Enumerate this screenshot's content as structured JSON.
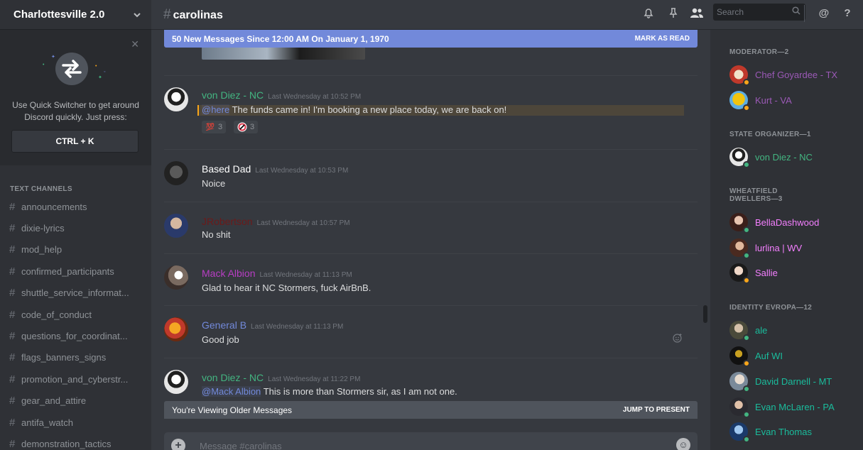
{
  "server": {
    "name": "Charlottesville 2.0"
  },
  "quick_switcher": {
    "text": "Use Quick Switcher to get around Discord quickly. Just press:",
    "shortcut": "CTRL + K"
  },
  "channels": {
    "category": "TEXT CHANNELS",
    "items": [
      "announcements",
      "dixie-lyrics",
      "mod_help",
      "confirmed_participants",
      "shuttle_service_informat...",
      "code_of_conduct",
      "questions_for_coordinat...",
      "flags_banners_signs",
      "promotion_and_cyberstr...",
      "gear_and_attire",
      "antifa_watch",
      "demonstration_tactics"
    ]
  },
  "header": {
    "channel": "carolinas",
    "search_placeholder": "Search"
  },
  "new_messages_bar": {
    "text": "50 New Messages Since 12:00 AM On January 1, 1970",
    "action": "MARK AS READ"
  },
  "older_messages_bar": {
    "text": "You're Viewing Older Messages",
    "action": "JUMP TO PRESENT"
  },
  "messages": [
    {
      "author": "von Diez - NC",
      "color": "#43b581",
      "timestamp": "Last Wednesday at 10:52 PM",
      "mention": "@here",
      "text": "The funds came in! I'm booking a new place today, we are back on!",
      "reactions": [
        {
          "count": "3"
        },
        {
          "count": "3"
        }
      ]
    },
    {
      "author": "Based Dad",
      "color": "#ffffff",
      "timestamp": "Last Wednesday at 10:53 PM",
      "text": "Noice"
    },
    {
      "author": "JRobertson",
      "color": "#6b1a1a",
      "timestamp": "Last Wednesday at 10:57 PM",
      "text": "No shit"
    },
    {
      "author": "Mack Albion",
      "color": "#b83ec4",
      "timestamp": "Last Wednesday at 11:13 PM",
      "text": "Glad to hear it NC Stormers, fuck AirBnB."
    },
    {
      "author": "General B",
      "color": "#7289da",
      "timestamp": "Last Wednesday at 11:13 PM",
      "text": "Good job"
    },
    {
      "author": "von Diez - NC",
      "color": "#43b581",
      "timestamp": "Last Wednesday at 11:22 PM",
      "mention": "@Mack Albion",
      "text": "This is more than Stormers sir, as I am not one."
    }
  ],
  "composer": {
    "placeholder": "Message #carolinas"
  },
  "members": {
    "roles": [
      {
        "label": "MODERATOR—2",
        "members": [
          {
            "name": "Chef Goyardee - TX",
            "color": "#9b59b6",
            "status": "#faa61a"
          },
          {
            "name": "Kurt - VA",
            "color": "#9b59b6",
            "status": "#faa61a"
          }
        ]
      },
      {
        "label": "STATE ORGANIZER—1",
        "members": [
          {
            "name": "von Diez - NC",
            "color": "#43b581",
            "status": "#43b581"
          }
        ]
      },
      {
        "label": "WHEATFIELD DWELLERS—3",
        "members": [
          {
            "name": "BellaDashwood",
            "color": "#f47fff",
            "status": "#43b581"
          },
          {
            "name": "lurlina | WV",
            "color": "#f47fff",
            "status": "#43b581"
          },
          {
            "name": "Sallie",
            "color": "#f47fff",
            "status": "#faa61a"
          }
        ]
      },
      {
        "label": "IDENTITY EVROPA—12",
        "members": [
          {
            "name": "ale",
            "color": "#1abc9c",
            "status": "#43b581"
          },
          {
            "name": "Auf WI",
            "color": "#1abc9c",
            "status": "#faa61a"
          },
          {
            "name": "David Darnell - MT",
            "color": "#1abc9c",
            "status": "#43b581"
          },
          {
            "name": "Evan McLaren - PA",
            "color": "#1abc9c",
            "status": "#43b581"
          },
          {
            "name": "Evan Thomas",
            "color": "#1abc9c",
            "status": "#43b581"
          }
        ]
      }
    ]
  }
}
